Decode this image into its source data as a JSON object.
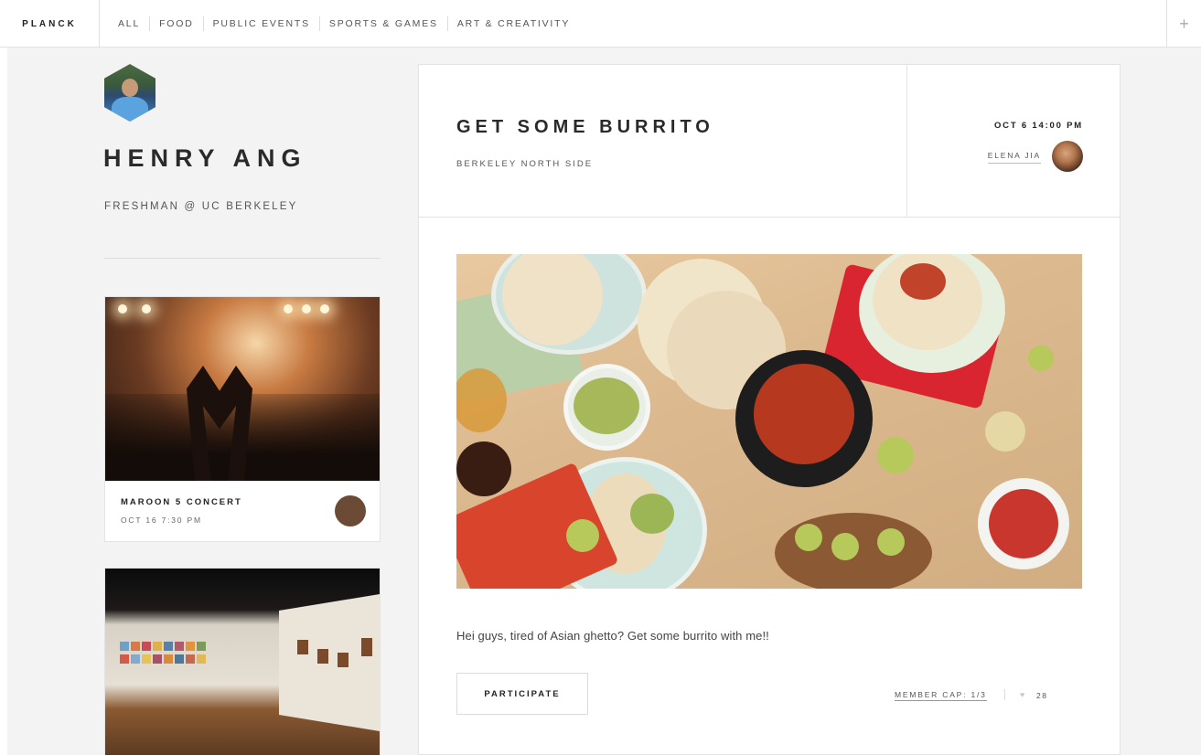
{
  "brand": "PLANCK",
  "nav": {
    "items": [
      "ALL",
      "FOOD",
      "PUBLIC EVENTS",
      "SPORTS & GAMES",
      "ART & CREATIVITY"
    ],
    "add_icon": "plus-icon"
  },
  "profile": {
    "name": "HENRY ANG",
    "subtitle": "FRESHMAN @ UC BERKELEY"
  },
  "events": [
    {
      "title": "MAROON 5 CONCERT",
      "date": "OCT 16 7:30 PM"
    }
  ],
  "post": {
    "title": "GET SOME BURRITO",
    "location": "BERKELEY NORTH SIDE",
    "datetime": "OCT 6 14:00 PM",
    "host": "ELENA JIA",
    "text": "Hei guys, tired of Asian ghetto? Get some burrito with me!!",
    "participate_label": "PARTICIPATE",
    "member_cap": "MEMBER CAP: 1/3",
    "likes": "28",
    "like_icon": "heart-icon"
  },
  "colors": {
    "background": "#f3f3f3",
    "panel": "#ffffff",
    "text": "#2b2b2b",
    "border": "#e3e3e3"
  }
}
